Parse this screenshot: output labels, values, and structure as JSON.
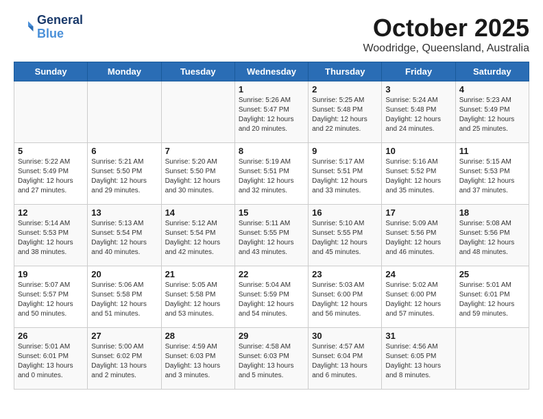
{
  "header": {
    "logo_line1": "General",
    "logo_line2": "Blue",
    "title": "October 2025",
    "subtitle": "Woodridge, Queensland, Australia"
  },
  "days_of_week": [
    "Sunday",
    "Monday",
    "Tuesday",
    "Wednesday",
    "Thursday",
    "Friday",
    "Saturday"
  ],
  "weeks": [
    [
      {
        "day": "",
        "info": ""
      },
      {
        "day": "",
        "info": ""
      },
      {
        "day": "",
        "info": ""
      },
      {
        "day": "1",
        "info": "Sunrise: 5:26 AM\nSunset: 5:47 PM\nDaylight: 12 hours\nand 20 minutes."
      },
      {
        "day": "2",
        "info": "Sunrise: 5:25 AM\nSunset: 5:48 PM\nDaylight: 12 hours\nand 22 minutes."
      },
      {
        "day": "3",
        "info": "Sunrise: 5:24 AM\nSunset: 5:48 PM\nDaylight: 12 hours\nand 24 minutes."
      },
      {
        "day": "4",
        "info": "Sunrise: 5:23 AM\nSunset: 5:49 PM\nDaylight: 12 hours\nand 25 minutes."
      }
    ],
    [
      {
        "day": "5",
        "info": "Sunrise: 5:22 AM\nSunset: 5:49 PM\nDaylight: 12 hours\nand 27 minutes."
      },
      {
        "day": "6",
        "info": "Sunrise: 5:21 AM\nSunset: 5:50 PM\nDaylight: 12 hours\nand 29 minutes."
      },
      {
        "day": "7",
        "info": "Sunrise: 5:20 AM\nSunset: 5:50 PM\nDaylight: 12 hours\nand 30 minutes."
      },
      {
        "day": "8",
        "info": "Sunrise: 5:19 AM\nSunset: 5:51 PM\nDaylight: 12 hours\nand 32 minutes."
      },
      {
        "day": "9",
        "info": "Sunrise: 5:17 AM\nSunset: 5:51 PM\nDaylight: 12 hours\nand 33 minutes."
      },
      {
        "day": "10",
        "info": "Sunrise: 5:16 AM\nSunset: 5:52 PM\nDaylight: 12 hours\nand 35 minutes."
      },
      {
        "day": "11",
        "info": "Sunrise: 5:15 AM\nSunset: 5:53 PM\nDaylight: 12 hours\nand 37 minutes."
      }
    ],
    [
      {
        "day": "12",
        "info": "Sunrise: 5:14 AM\nSunset: 5:53 PM\nDaylight: 12 hours\nand 38 minutes."
      },
      {
        "day": "13",
        "info": "Sunrise: 5:13 AM\nSunset: 5:54 PM\nDaylight: 12 hours\nand 40 minutes."
      },
      {
        "day": "14",
        "info": "Sunrise: 5:12 AM\nSunset: 5:54 PM\nDaylight: 12 hours\nand 42 minutes."
      },
      {
        "day": "15",
        "info": "Sunrise: 5:11 AM\nSunset: 5:55 PM\nDaylight: 12 hours\nand 43 minutes."
      },
      {
        "day": "16",
        "info": "Sunrise: 5:10 AM\nSunset: 5:55 PM\nDaylight: 12 hours\nand 45 minutes."
      },
      {
        "day": "17",
        "info": "Sunrise: 5:09 AM\nSunset: 5:56 PM\nDaylight: 12 hours\nand 46 minutes."
      },
      {
        "day": "18",
        "info": "Sunrise: 5:08 AM\nSunset: 5:56 PM\nDaylight: 12 hours\nand 48 minutes."
      }
    ],
    [
      {
        "day": "19",
        "info": "Sunrise: 5:07 AM\nSunset: 5:57 PM\nDaylight: 12 hours\nand 50 minutes."
      },
      {
        "day": "20",
        "info": "Sunrise: 5:06 AM\nSunset: 5:58 PM\nDaylight: 12 hours\nand 51 minutes."
      },
      {
        "day": "21",
        "info": "Sunrise: 5:05 AM\nSunset: 5:58 PM\nDaylight: 12 hours\nand 53 minutes."
      },
      {
        "day": "22",
        "info": "Sunrise: 5:04 AM\nSunset: 5:59 PM\nDaylight: 12 hours\nand 54 minutes."
      },
      {
        "day": "23",
        "info": "Sunrise: 5:03 AM\nSunset: 6:00 PM\nDaylight: 12 hours\nand 56 minutes."
      },
      {
        "day": "24",
        "info": "Sunrise: 5:02 AM\nSunset: 6:00 PM\nDaylight: 12 hours\nand 57 minutes."
      },
      {
        "day": "25",
        "info": "Sunrise: 5:01 AM\nSunset: 6:01 PM\nDaylight: 12 hours\nand 59 minutes."
      }
    ],
    [
      {
        "day": "26",
        "info": "Sunrise: 5:01 AM\nSunset: 6:01 PM\nDaylight: 13 hours\nand 0 minutes."
      },
      {
        "day": "27",
        "info": "Sunrise: 5:00 AM\nSunset: 6:02 PM\nDaylight: 13 hours\nand 2 minutes."
      },
      {
        "day": "28",
        "info": "Sunrise: 4:59 AM\nSunset: 6:03 PM\nDaylight: 13 hours\nand 3 minutes."
      },
      {
        "day": "29",
        "info": "Sunrise: 4:58 AM\nSunset: 6:03 PM\nDaylight: 13 hours\nand 5 minutes."
      },
      {
        "day": "30",
        "info": "Sunrise: 4:57 AM\nSunset: 6:04 PM\nDaylight: 13 hours\nand 6 minutes."
      },
      {
        "day": "31",
        "info": "Sunrise: 4:56 AM\nSunset: 6:05 PM\nDaylight: 13 hours\nand 8 minutes."
      },
      {
        "day": "",
        "info": ""
      }
    ]
  ]
}
